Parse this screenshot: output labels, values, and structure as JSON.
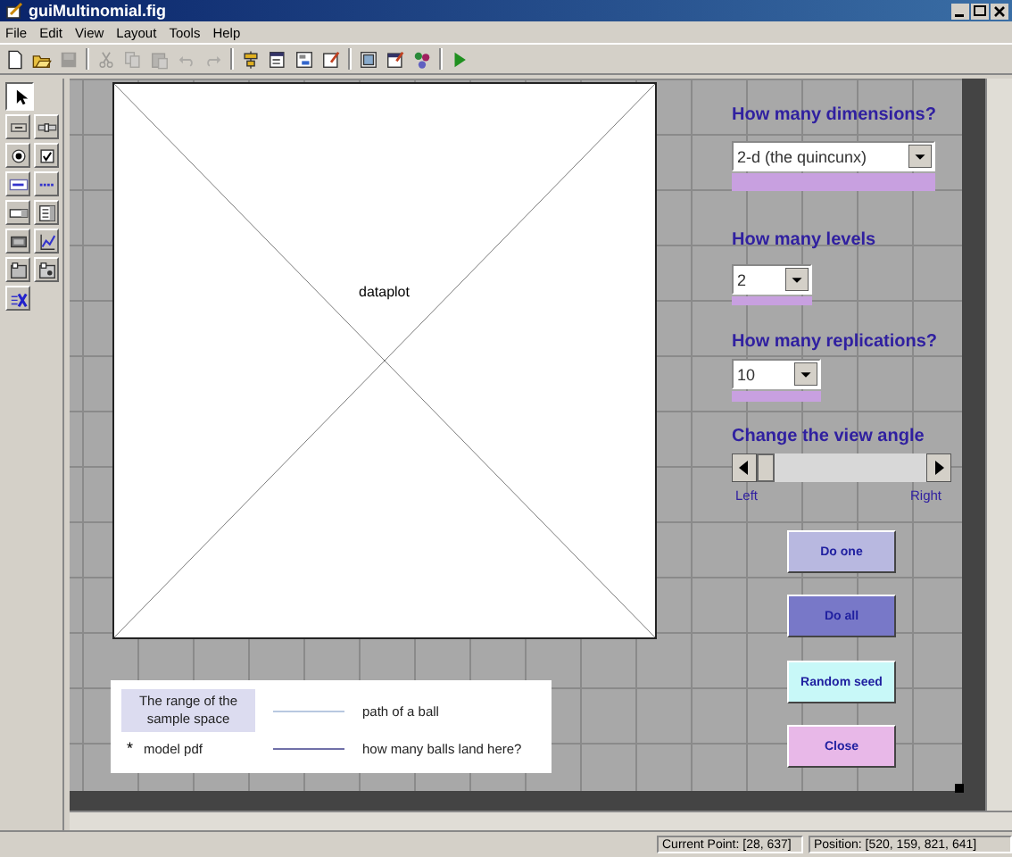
{
  "window": {
    "title": "guiMultinomial.fig"
  },
  "menu": [
    "File",
    "Edit",
    "View",
    "Layout",
    "Tools",
    "Help"
  ],
  "toolbar": [
    {
      "kind": "new",
      "disabled": false
    },
    {
      "kind": "open",
      "disabled": false
    },
    {
      "kind": "save",
      "disabled": true
    },
    {
      "kind": "sep"
    },
    {
      "kind": "cut",
      "disabled": true
    },
    {
      "kind": "copy",
      "disabled": true
    },
    {
      "kind": "paste",
      "disabled": true
    },
    {
      "kind": "undo",
      "disabled": true
    },
    {
      "kind": "redo",
      "disabled": true
    },
    {
      "kind": "sep"
    },
    {
      "kind": "align",
      "disabled": false
    },
    {
      "kind": "menu",
      "disabled": false
    },
    {
      "kind": "taborder",
      "disabled": false
    },
    {
      "kind": "editor",
      "disabled": false
    },
    {
      "kind": "sep"
    },
    {
      "kind": "inspector",
      "disabled": false
    },
    {
      "kind": "browser",
      "disabled": false
    },
    {
      "kind": "objects",
      "disabled": false
    },
    {
      "kind": "sep"
    },
    {
      "kind": "run",
      "disabled": false
    }
  ],
  "palette": [
    {
      "kind": "pointer",
      "selected": true
    },
    {
      "kind": "push",
      "selected": false
    },
    {
      "kind": "slider",
      "selected": false
    },
    {
      "kind": "radio",
      "selected": false
    },
    {
      "kind": "check",
      "selected": false
    },
    {
      "kind": "edit",
      "selected": false
    },
    {
      "kind": "text",
      "selected": false
    },
    {
      "kind": "popup",
      "selected": false
    },
    {
      "kind": "listbox",
      "selected": false
    },
    {
      "kind": "toggle",
      "selected": false
    },
    {
      "kind": "axes",
      "selected": false
    },
    {
      "kind": "panel",
      "selected": false
    },
    {
      "kind": "group",
      "selected": false
    },
    {
      "kind": "activex",
      "selected": false
    }
  ],
  "canvas": {
    "axes": {
      "label": "dataplot"
    },
    "legend": [
      {
        "kind": "patch",
        "text": "The range of the sample space"
      },
      {
        "kind": "line",
        "text": "path of a ball",
        "color": "#b8c8e0"
      },
      {
        "kind": "marker",
        "marker": "*",
        "text": "model pdf"
      },
      {
        "kind": "line",
        "text": "how many balls land here?",
        "color": "#7070a8"
      }
    ],
    "controls": [
      {
        "kind": "label",
        "text": "How many dimensions?"
      },
      {
        "kind": "popup",
        "value": "2-d (the quincunx)"
      },
      {
        "kind": "bar",
        "color": "#c8a0e0"
      },
      {
        "kind": "label",
        "text": "How many levels"
      },
      {
        "kind": "popup",
        "value": "2"
      },
      {
        "kind": "bar",
        "color": "#c8a0e0"
      },
      {
        "kind": "label",
        "text": "How many replications?"
      },
      {
        "kind": "popup",
        "value": "10"
      },
      {
        "kind": "bar",
        "color": "#c8a0e0"
      },
      {
        "kind": "label",
        "text": "Change the view angle"
      },
      {
        "kind": "slider",
        "level": 0
      },
      {
        "kind": "note",
        "text": "Left"
      },
      {
        "kind": "note",
        "text": "Right"
      },
      {
        "kind": "button",
        "text": "Do one",
        "color": "#b8b8e0"
      },
      {
        "kind": "button",
        "text": "Do all",
        "color": "#7878c8"
      },
      {
        "kind": "button",
        "text": "Random seed",
        "color": "#c8f8f8"
      },
      {
        "kind": "button",
        "text": "Close",
        "color": "#e8b8e8"
      }
    ]
  },
  "status_bar": [
    "Current Point:  [28, 637]",
    "Position:  [520, 159, 821, 641]"
  ]
}
